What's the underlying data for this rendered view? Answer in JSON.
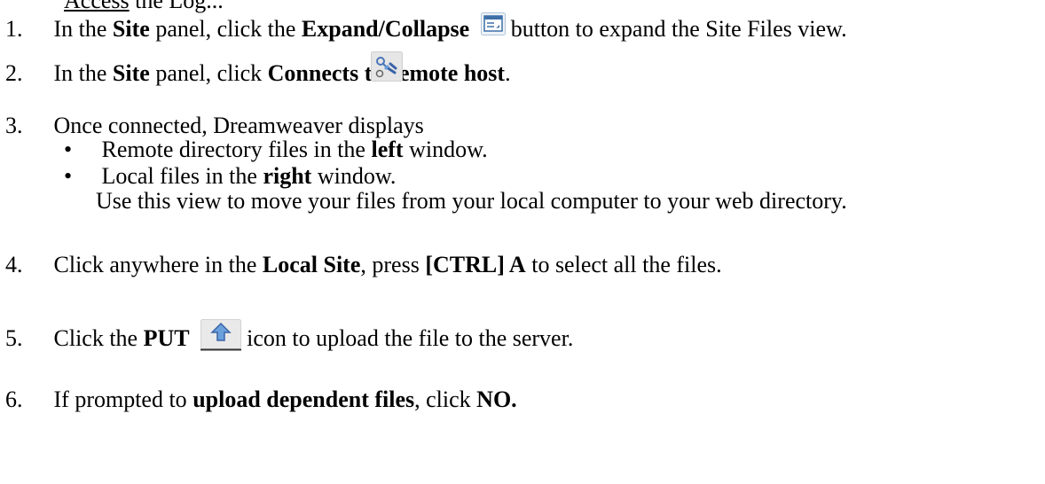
{
  "header_fragment": {
    "underlined": "Access",
    "rest": "the Log..."
  },
  "steps": [
    {
      "num": "1.",
      "t1": "In the ",
      "b1": "Site",
      "t2": " panel, click the ",
      "b2": "Expand/Collapse",
      "t3": "button to expand the Site Files view."
    },
    {
      "num": "2.",
      "t1": "In the ",
      "b1": "Site",
      "t2": " panel, click ",
      "b2": "Connects to remote host",
      "t3": "."
    },
    {
      "num": "3.",
      "t1": "Once connected, Dreamweaver displays",
      "bullets": [
        {
          "t1": "Remote directory files in the ",
          "b1": "left",
          "t2": " window."
        },
        {
          "t1": "Local files in the ",
          "b1": "right",
          "t2": " window."
        }
      ],
      "extra": "Use this view to move your files from your local computer to your web directory."
    },
    {
      "num": "4.",
      "t1": "Click anywhere in the ",
      "b1": "Local Site",
      "t2": ", press ",
      "b2": "[CTRL] A",
      "t3": " to select all the files."
    },
    {
      "num": "5.",
      "t1": "Click the ",
      "b1": "PUT",
      "t2": "icon to upload the file to the server."
    },
    {
      "num": "6.",
      "t1": "If prompted to ",
      "b1": "upload dependent files",
      "t2": ", click ",
      "b2": "NO."
    }
  ],
  "icons": {
    "expand_collapse": "expand-collapse-icon",
    "connect": "connect-plug-icon",
    "put": "put-upload-arrow-icon"
  },
  "colors": {
    "text": "#000000",
    "icon_border": "#7f9db9",
    "put_blue": "#6aa0dc"
  }
}
